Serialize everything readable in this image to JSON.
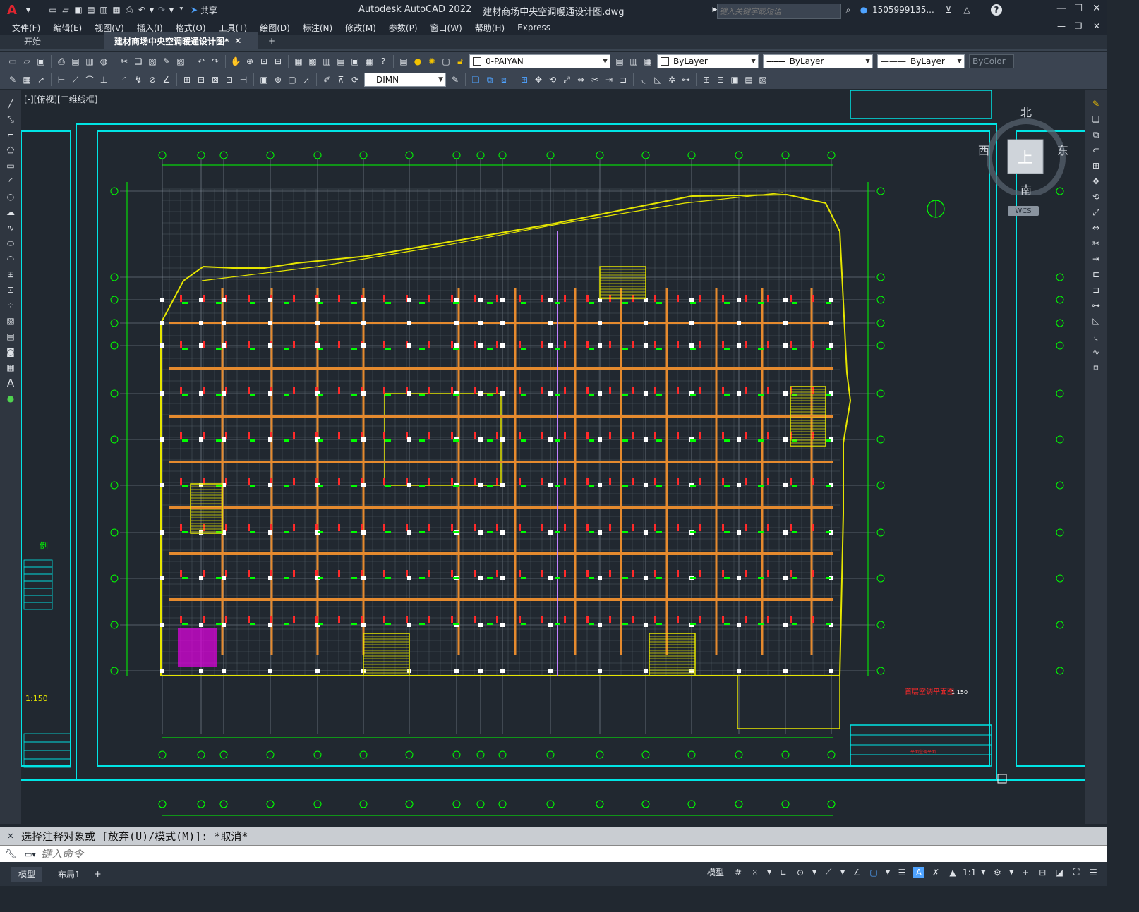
{
  "titlebar": {
    "app_title": "Autodesk AutoCAD 2022",
    "file_name": "建材商场中央空调暖通设计图.dwg",
    "share_label": "共享",
    "search_placeholder": "键入关键字或短语",
    "user_name": "1505999135...",
    "help_icon": "question-icon"
  },
  "menu": {
    "items": [
      "文件(F)",
      "编辑(E)",
      "视图(V)",
      "插入(I)",
      "格式(O)",
      "工具(T)",
      "绘图(D)",
      "标注(N)",
      "修改(M)",
      "参数(P)",
      "窗口(W)",
      "帮助(H)",
      "Express"
    ]
  },
  "tabs": {
    "start": "开始",
    "active": "建材商场中央空调暖通设计图*"
  },
  "toolbar": {
    "layer": "0-PAIYAN",
    "color": "ByLayer",
    "linetype": "ByLayer",
    "lineweight": "ByLayer",
    "plotstyle": "ByColor",
    "dimstyle": "DIMN"
  },
  "viewport": {
    "label": "[-][俯视][二维线框]"
  },
  "viewcube": {
    "north": "北",
    "south": "南",
    "east": "东",
    "west": "西",
    "top": "上",
    "wcs": "WCS"
  },
  "drawing": {
    "plan_title": "首层空调平面图",
    "plan_scale": "1:150",
    "left_scale": "1:150",
    "left_heading": "例",
    "title_block_right": "平面空调平面",
    "colors": {
      "frame": "#00e5e5",
      "grid": "#ffffff",
      "axis": "#00ff00",
      "wall": "#e6e600",
      "duct": "#e58a2e",
      "text": "#00ff00",
      "accent": "#ff2a2a",
      "magenta": "#e600e6"
    }
  },
  "command": {
    "history": "选择注释对象或 [放弃(U)/模式(M)]: *取消*",
    "input_placeholder": "键入命令"
  },
  "status": {
    "model_tab": "模型",
    "layout_tab": "布局1",
    "model_label": "模型",
    "scale": "1:1"
  }
}
